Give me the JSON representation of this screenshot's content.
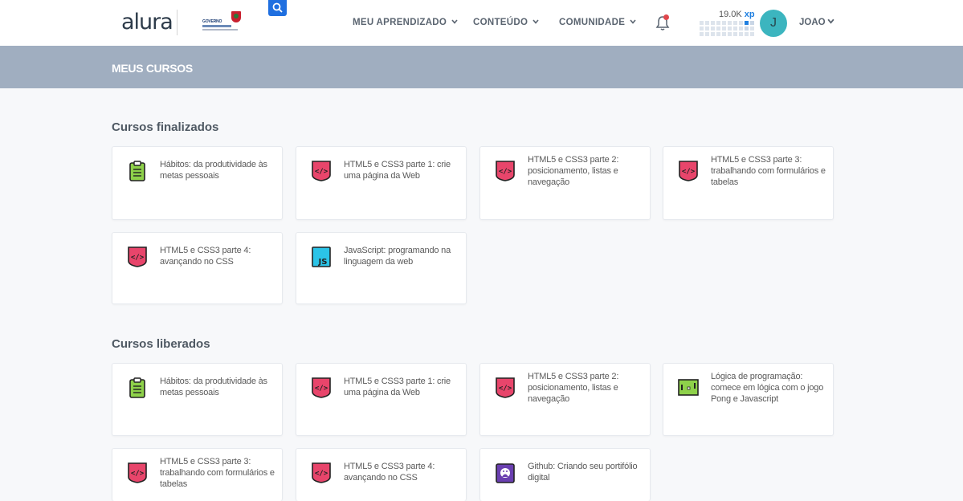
{
  "header": {
    "logo": "alura",
    "nav": [
      {
        "label": "MEU APRENDIZADO"
      },
      {
        "label": "CONTEÚDO"
      },
      {
        "label": "COMUNIDADE"
      }
    ],
    "xp_value": "19.0K",
    "xp_unit": "xp",
    "avatar_initial": "J",
    "user_name": "JOAO"
  },
  "banner": {
    "title": "MEUS CURSOS"
  },
  "sections": [
    {
      "title": "Cursos finalizados",
      "courses": [
        {
          "title": "Hábitos: da produtividade às metas pessoais",
          "icon": "clipboard-icon"
        },
        {
          "title": "HTML5 e CSS3 parte 1: crie uma página da Web",
          "icon": "html-code-icon"
        },
        {
          "title": "HTML5 e CSS3 parte 2: posicionamento, listas e navegação",
          "icon": "html-code-icon"
        },
        {
          "title": "HTML5 e CSS3 parte 3: trabalhando com formulários e tabelas",
          "icon": "html-code-icon"
        },
        {
          "title": "HTML5 e CSS3 parte 4: avançando no CSS",
          "icon": "html-code-icon"
        },
        {
          "title": "JavaScript: programando na linguagem da web",
          "icon": "js-icon"
        }
      ]
    },
    {
      "title": "Cursos liberados",
      "courses": [
        {
          "title": "Hábitos: da produtividade às metas pessoais",
          "icon": "clipboard-icon"
        },
        {
          "title": "HTML5 e CSS3 parte 1: crie uma página da Web",
          "icon": "html-code-icon"
        },
        {
          "title": "HTML5 e CSS3 parte 2: posicionamento, listas e navegação",
          "icon": "html-code-icon"
        },
        {
          "title": "Lógica de programação: comece em lógica com o jogo Pong e Javascript",
          "icon": "pong-game-icon"
        },
        {
          "title": "HTML5 e CSS3 parte 3: trabalhando com formulários e tabelas",
          "icon": "html-code-icon"
        },
        {
          "title": "HTML5 e CSS3 parte 4: avançando no CSS",
          "icon": "html-code-icon"
        },
        {
          "title": "Github: Criando seu portifólio digital",
          "icon": "github-icon"
        }
      ]
    }
  ],
  "colors": {
    "banner": "#a0aec0",
    "brand_blue": "#1f6fe0",
    "html_pink": "#e8456b",
    "avatar": "#3cb5bf"
  }
}
